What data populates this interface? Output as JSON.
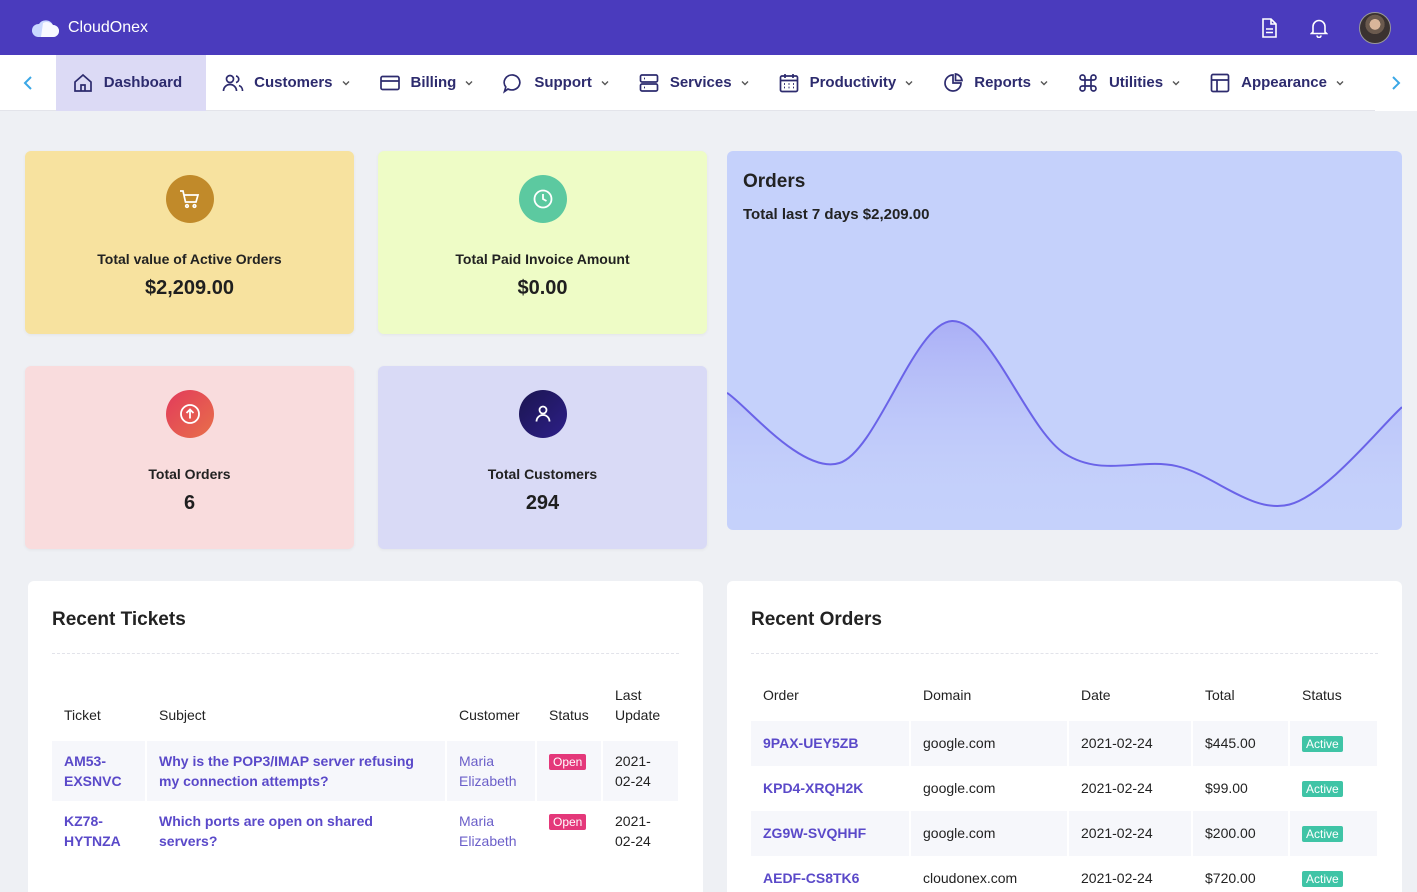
{
  "app": {
    "name": "CloudOnex"
  },
  "colors": {
    "topbar": "#4a3bbd",
    "accent": "#5a49c9",
    "open_badge": "#e4387a",
    "active_badge": "#3fc4a6"
  },
  "nav": {
    "items": [
      {
        "label": "Dashboard",
        "icon": "home-icon"
      },
      {
        "label": "Customers",
        "icon": "users-icon"
      },
      {
        "label": "Billing",
        "icon": "credit-card-icon"
      },
      {
        "label": "Support",
        "icon": "chat-icon"
      },
      {
        "label": "Services",
        "icon": "server-icon"
      },
      {
        "label": "Productivity",
        "icon": "calendar-icon"
      },
      {
        "label": "Reports",
        "icon": "pie-chart-icon"
      },
      {
        "label": "Utilities",
        "icon": "command-icon"
      },
      {
        "label": "Appearance",
        "icon": "layout-icon"
      }
    ]
  },
  "stats": [
    {
      "label": "Total value of Active Orders",
      "value": "$2,209.00",
      "icon": "cart-icon"
    },
    {
      "label": "Total Paid Invoice Amount",
      "value": "$0.00",
      "icon": "clock-icon"
    },
    {
      "label": "Total Orders",
      "value": "6",
      "icon": "arrow-up-circle-icon"
    },
    {
      "label": "Total Customers",
      "value": "294",
      "icon": "user-icon"
    }
  ],
  "orders_chart": {
    "title": "Orders",
    "subtitle": "Total last 7 days $2,209.00"
  },
  "chart_data": {
    "type": "area",
    "title": "Orders",
    "subtitle": "Total last 7 days $2,209.00",
    "x": [
      0,
      1,
      2,
      3,
      4,
      5,
      6
    ],
    "values": [
      860,
      420,
      1310,
      480,
      400,
      160,
      770
    ],
    "ylim": [
      0,
      2000
    ],
    "color": "#6a63e8"
  },
  "tickets": {
    "title": "Recent Tickets",
    "headers": {
      "ticket": "Ticket",
      "subject": "Subject",
      "customer": "Customer",
      "status": "Status",
      "last_update": "Last Update"
    },
    "rows": [
      {
        "ticket": "AM53-EXSNVC",
        "subject": "Why is the POP3/IMAP server refusing my connection attempts?",
        "customer": "Maria Elizabeth",
        "status": "Open",
        "last_update": "2021-02-24"
      },
      {
        "ticket": "KZ78-HYTNZA",
        "subject": "Which ports are open on shared servers?",
        "customer": "Maria Elizabeth",
        "status": "Open",
        "last_update": "2021-02-24"
      }
    ]
  },
  "orders": {
    "title": "Recent Orders",
    "headers": {
      "order": "Order",
      "domain": "Domain",
      "date": "Date",
      "total": "Total",
      "status": "Status"
    },
    "rows": [
      {
        "order": "9PAX-UEY5ZB",
        "domain": "google.com",
        "date": "2021-02-24",
        "total": "$445.00",
        "status": "Active"
      },
      {
        "order": "KPD4-XRQH2K",
        "domain": "google.com",
        "date": "2021-02-24",
        "total": "$99.00",
        "status": "Active"
      },
      {
        "order": "ZG9W-SVQHHF",
        "domain": "google.com",
        "date": "2021-02-24",
        "total": "$200.00",
        "status": "Active"
      },
      {
        "order": "AEDF-CS8TK6",
        "domain": "cloudonex.com",
        "date": "2021-02-24",
        "total": "$720.00",
        "status": "Active"
      }
    ]
  }
}
